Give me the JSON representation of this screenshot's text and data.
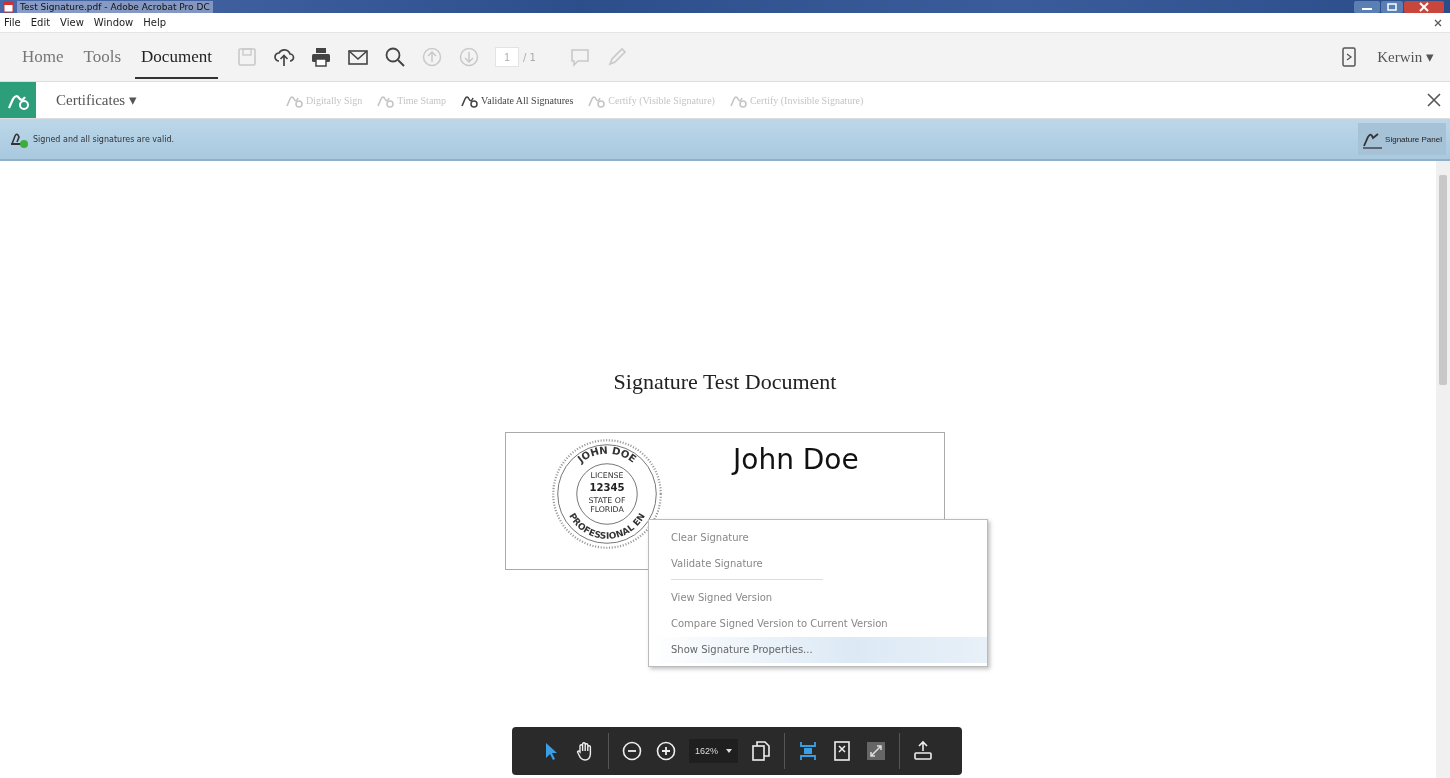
{
  "window": {
    "title": "Test Signature.pdf - Adobe Acrobat Pro DC"
  },
  "menu": [
    "File",
    "Edit",
    "View",
    "Window",
    "Help"
  ],
  "tabs": [
    {
      "label": "Home",
      "selected": false
    },
    {
      "label": "Tools",
      "selected": false
    },
    {
      "label": "Document",
      "selected": true
    }
  ],
  "toolbar": {
    "tools": [
      {
        "kind": "save",
        "disabled": true
      },
      {
        "kind": "upload",
        "disabled": false
      },
      {
        "kind": "print",
        "disabled": false
      },
      {
        "kind": "mail",
        "disabled": false
      },
      {
        "kind": "search",
        "disabled": false
      },
      {
        "kind": "up",
        "disabled": true
      },
      {
        "kind": "down",
        "disabled": true
      }
    ],
    "page": "1",
    "page_total": "/ 1",
    "extra_tools": [
      {
        "kind": "comment",
        "disabled": true
      },
      {
        "kind": "pen",
        "disabled": true
      }
    ],
    "user": "Kerwin ▾"
  },
  "certificates": {
    "title": "Certificates ▾",
    "tools": [
      {
        "label": "Digitally Sign",
        "disabled": true
      },
      {
        "label": "Time Stamp",
        "disabled": true
      },
      {
        "label": "Validate All Signatures",
        "disabled": false
      },
      {
        "label": "Certify (Visible Signature)",
        "disabled": true
      },
      {
        "label": "Certify (Invisible Signature)",
        "disabled": true
      }
    ]
  },
  "status": {
    "message": "Signed and all signatures are valid.",
    "panel_button": "Signature Panel"
  },
  "document": {
    "heading": "Signature Test Document",
    "seal": {
      "top": "JOHN DOE",
      "license": "LICENSE",
      "number": "12345",
      "state": "STATE OF",
      "state_name": "FLORIDA",
      "bottom": "PROFESSIONAL EN"
    },
    "signer": "John Doe"
  },
  "context_menu": [
    {
      "label": "Clear Signature",
      "selected": false,
      "separator_after": false
    },
    {
      "label": "Validate Signature",
      "selected": false,
      "separator_after": true
    },
    {
      "label": "View Signed Version",
      "selected": false,
      "separator_after": false
    },
    {
      "label": "Compare Signed Version to Current Version",
      "selected": false,
      "separator_after": false
    },
    {
      "label": "Show Signature Properties...",
      "selected": true,
      "separator_after": false
    }
  ],
  "floating_toolbar": {
    "zoom": "162%"
  }
}
